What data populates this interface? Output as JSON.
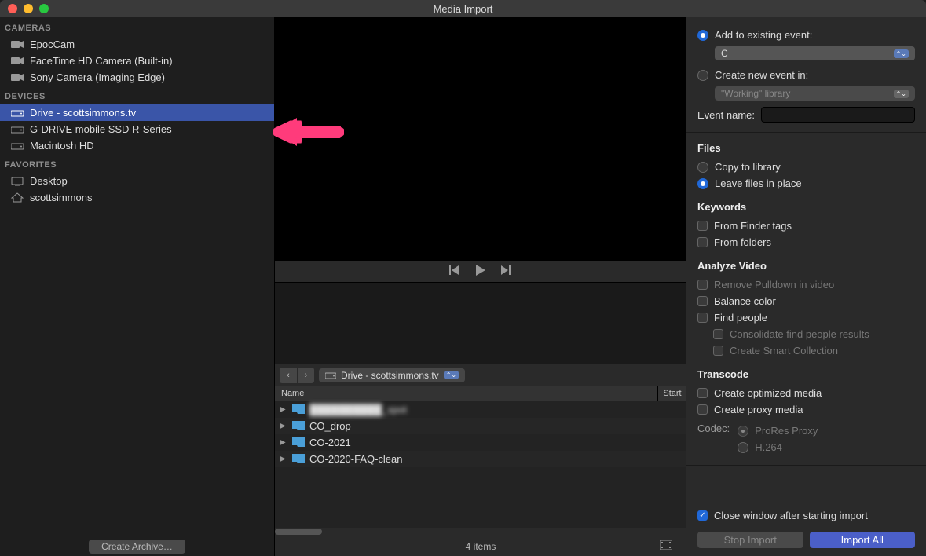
{
  "window": {
    "title": "Media Import"
  },
  "sidebar": {
    "sections": {
      "cameras": {
        "header": "CAMERAS",
        "items": [
          {
            "label": "EpocCam"
          },
          {
            "label": "FaceTime HD Camera (Built-in)"
          },
          {
            "label": "Sony Camera (Imaging Edge)"
          }
        ]
      },
      "devices": {
        "header": "DEVICES",
        "items": [
          {
            "label": "Drive - scottsimmons.tv",
            "selected": true
          },
          {
            "label": "G-DRIVE mobile SSD R-Series"
          },
          {
            "label": "Macintosh HD"
          }
        ]
      },
      "favorites": {
        "header": "FAVORITES",
        "items": [
          {
            "label": "Desktop"
          },
          {
            "label": "scottsimmons"
          }
        ]
      }
    },
    "footer": {
      "create_archive": "Create Archive…"
    }
  },
  "browser": {
    "path": "Drive - scottsimmons.tv",
    "columns": {
      "name": "Name",
      "start": "Start"
    },
    "rows": [
      {
        "name": "██████████_spot",
        "blurred": true
      },
      {
        "name": "CO_drop"
      },
      {
        "name": "CO-2021"
      },
      {
        "name": "CO-2020-FAQ-clean"
      }
    ],
    "footer": {
      "count": "4 items"
    }
  },
  "import": {
    "add_to_existing": "Add to existing event:",
    "existing_event_value": "C",
    "create_new_event": "Create new event in:",
    "new_event_location": "\"Working\" library",
    "event_name_label": "Event name:",
    "event_name_value": "",
    "files": {
      "heading": "Files",
      "copy": "Copy to library",
      "leave": "Leave files in place"
    },
    "keywords": {
      "heading": "Keywords",
      "finder_tags": "From Finder tags",
      "folders": "From folders"
    },
    "analyze": {
      "heading": "Analyze Video",
      "remove_pulldown": "Remove Pulldown in video",
      "balance_color": "Balance color",
      "find_people": "Find people",
      "consolidate": "Consolidate find people results",
      "smart_collection": "Create Smart Collection"
    },
    "transcode": {
      "heading": "Transcode",
      "optimized": "Create optimized media",
      "proxy": "Create proxy media",
      "codec_label": "Codec:",
      "prores": "ProRes Proxy",
      "h264": "H.264"
    },
    "close_after": "Close window after starting import",
    "stop_import": "Stop Import",
    "import_all": "Import All"
  }
}
